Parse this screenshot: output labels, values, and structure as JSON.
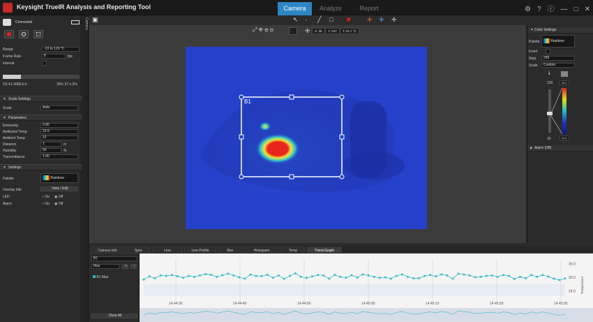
{
  "app": {
    "title": "Keysight TrueIR Analysis and Reporting Tool"
  },
  "tabs": [
    {
      "label": "Camera",
      "active": true
    },
    {
      "label": "Analyze",
      "active": false
    },
    {
      "label": "Report",
      "active": false
    }
  ],
  "window_controls": {
    "settings_icon": "gear-icon",
    "help_icon": "help-icon",
    "info_icon": "info-icon",
    "minimize": "—",
    "restore": "□",
    "close": "✕"
  },
  "left": {
    "status": "Connected",
    "range_label": "Range",
    "range_value": "-20 to 120 °C",
    "frame_rate_label": "Frame Rate",
    "frame_rate_value": "8",
    "frame_rate_unit": "fps",
    "interval_label": "Interval",
    "device_info": "C6-41-3066-k-k",
    "device_fps": "35% 37 n 2%",
    "scale_section": "Scale Settings",
    "scale_label": "Scale",
    "scale_value": "Auto",
    "params_section": "Parameters",
    "params": [
      {
        "label": "Emissivity",
        "value": "0.95",
        "unit": ""
      },
      {
        "label": "Reflected Temp",
        "value": "23.5",
        "unit": ""
      },
      {
        "label": "Ambient Temp",
        "value": "22",
        "unit": ""
      },
      {
        "label": "Distance",
        "value": "1",
        "unit": "m"
      },
      {
        "label": "Humidity",
        "value": "50",
        "unit": "%"
      },
      {
        "label": "Transmittance",
        "value": "1.00",
        "unit": ""
      }
    ],
    "settings_section": "Settings",
    "palette_label": "Palette",
    "palette_value": "Rainbow",
    "overlay_label": "Overlay Info",
    "overlay_button": "View / Edit",
    "led_label": "LED",
    "alarm_label": "Alarm",
    "on": "On",
    "off": "Off"
  },
  "camera_tab": "Camera",
  "coords": {
    "x": "X: 36",
    "y": "Y: 237",
    "t": "T: 22.7 °C"
  },
  "box_label": "B1",
  "thermal_colors": {
    "bg": "#2541c9",
    "hot": "#e8251c",
    "warm": "#f2e43a",
    "mid": "#33c3c9"
  },
  "right": {
    "color_section": "Color Settings",
    "palette_label": "Palette",
    "palette_value": "Rainbow",
    "invert_label": "Invert",
    "step_label": "Step",
    "step_value": "256",
    "scale_label": "Scale",
    "scale_value": "Custom",
    "top_value": "120",
    "bottom_value": "20",
    "hi_value": "36.0",
    "lo_value": "24.0",
    "alarm_section": "Alarm (Off)"
  },
  "bottom_tabs": [
    "Camera Info",
    "Spot",
    "Line",
    "Line Profile",
    "Box",
    "Histogram",
    "Temp",
    "Trend Graph"
  ],
  "trend": {
    "item": "B1",
    "stat": "Max",
    "series_label": "B1 Max",
    "clear_all": "Clear All"
  },
  "chart_data": {
    "type": "line",
    "x": [
      "14:44:30",
      "14:44:40",
      "14:44:50",
      "14:45:00",
      "14:45:10",
      "14:45:20",
      "14:45:30"
    ],
    "y_ticks": [
      "36.0",
      "30.0",
      "24.0"
    ],
    "ylabel": "Temperature",
    "series": [
      {
        "name": "B1 Max",
        "color": "#35b6c6",
        "values": [
          29.0,
          30.4,
          29.6,
          30.8,
          30.6,
          31.0,
          30.5,
          29.8,
          30.6,
          30.2,
          30.8,
          31.4,
          31.1,
          30.2,
          30.9,
          31.6,
          30.8,
          30.0,
          29.4,
          31.2,
          30.6,
          30.5,
          31.1,
          29.8,
          30.8,
          29.3,
          30.6,
          31.7,
          30.2,
          29.7,
          30.4,
          31.0,
          30.8,
          29.4,
          31.0,
          30.2,
          29.8,
          30.9,
          29.9,
          31.3,
          30.8,
          30.2,
          29.8,
          30.0,
          29.4,
          30.6,
          31.3,
          30.2,
          29.6,
          29.6,
          30.6,
          31.0,
          30.4,
          31.3,
          30.8,
          29.4,
          31.6,
          31.2,
          30.8,
          30.0,
          30.2,
          30.6,
          30.8,
          30.2,
          31.0,
          30.6,
          29.3,
          30.2,
          29.6,
          31.0,
          30.2,
          31.0,
          30.3,
          29.4,
          28.8,
          29.5
        ]
      }
    ]
  }
}
